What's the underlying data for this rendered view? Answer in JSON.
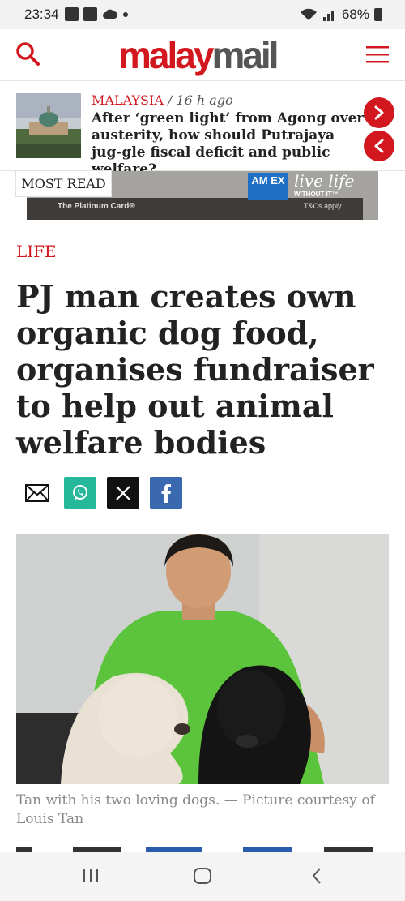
{
  "status_bar": {
    "time": "23:34",
    "battery": "68%"
  },
  "header": {
    "logo_part1": "malay",
    "logo_part2": "mail"
  },
  "latest": {
    "category": "MALAYSIA",
    "separator": "/",
    "time": "16 h ago",
    "title": "After ‘green light’ from Agong over austerity, how should Putrajaya jug-gle fiscal deficit and public welfare?"
  },
  "ad": {
    "card": "The Platinum Card®",
    "brand": "AM EX",
    "tagline": "live life",
    "tagline_sub": "WITHOUT IT™",
    "terms": "T&Cs apply."
  },
  "most_read_label": "MOST READ",
  "article": {
    "category": "LIFE",
    "headline": "PJ man creates own organic dog food, organises fundraiser to help out animal welfare bodies",
    "caption": "Tan with his two loving dogs. — Picture courtesy of Louis Tan"
  },
  "share": [
    "email-icon",
    "whatsapp-icon",
    "x-icon",
    "facebook-icon"
  ],
  "colors": {
    "brand_red": "#d2171e",
    "whatsapp": "#25b89a",
    "facebook": "#3b69b0",
    "x": "#111111"
  }
}
